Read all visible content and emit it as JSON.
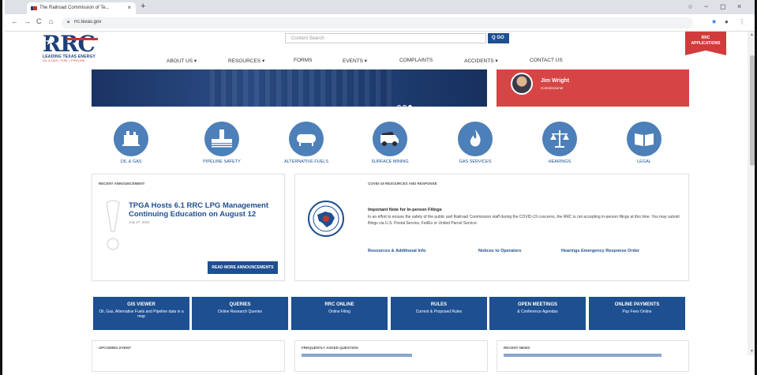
{
  "browser": {
    "tab_title": "The Railroad Commission of Te...",
    "tab_close": "×",
    "new_tab": "+",
    "url": "rrc.texas.gov",
    "win_controls": [
      "○",
      "−",
      "◻",
      "×"
    ]
  },
  "header": {
    "logo_text": "RRC",
    "logo_tagline": "LEADING TEXAS ENERGY",
    "logo_sub": "OIL & GAS • FUEL • PIPELINE",
    "search_placeholder": "Content Search",
    "go_label": "Q GO",
    "apps_label_1": "RRC",
    "apps_label_2": "APPLICATIONS"
  },
  "nav": {
    "items": [
      "ABOUT US ▾",
      "RESOURCES ▾",
      "FORMS",
      "EVENTS ▾",
      "COMPLAINTS",
      "ACCIDENTS ▾",
      "CONTACT US"
    ]
  },
  "hero": {
    "commissioner_name": "Jim Wright",
    "commissioner_role": "Commissioner"
  },
  "categories": [
    {
      "label": "OIL & GAS",
      "icon": "oil-rig-icon"
    },
    {
      "label": "PIPELINE SAFETY",
      "icon": "pipeline-icon"
    },
    {
      "label": "ALTERNATIVE FUELS",
      "icon": "fuel-tank-icon"
    },
    {
      "label": "SURFACE MINING",
      "icon": "mining-truck-icon"
    },
    {
      "label": "GAS SERVICES",
      "icon": "flame-icon"
    },
    {
      "label": "HEARINGS",
      "icon": "scales-icon"
    },
    {
      "label": "LEGAL",
      "icon": "book-icon"
    }
  ],
  "announcement": {
    "section_title": "RECENT ANNOUNCEMENT",
    "headline": "TPGA Hosts 6.1 RRC LPG Management Continuing Education on August 12",
    "date": "July 27, 2021",
    "button": "READ MORE ANNOUNCEMENTS"
  },
  "covid": {
    "section_title": "COVID-19 RESOURCES AND RESPONSE",
    "note_title": "Important Note for In-person Filings",
    "note_body": "In an effort to ensure the safety of the public and Railroad Commission staff during the COVID-19 concerns, the RRC is not accepting in-person filings at this time. You may submit filings via U.S. Postal Service, FedEx or United Parcel Service.",
    "links": [
      "Resources & Additional Info",
      "Notices to Operators",
      "Hearings Emergency Response Order"
    ]
  },
  "tiles": [
    {
      "title": "GIS VIEWER",
      "sub": "Oil, Gas, Alternative Fuels and Pipeline data in a map"
    },
    {
      "title": "QUERIES",
      "sub": "Online Research Queries"
    },
    {
      "title": "RRC ONLINE",
      "sub": "Online Filing"
    },
    {
      "title": "RULES",
      "sub": "Current & Proposed Rules"
    },
    {
      "title": "OPEN MEETINGS",
      "sub": "& Conference Agendas"
    },
    {
      "title": "ONLINE PAYMENTS",
      "sub": "Pay Fees Online"
    }
  ],
  "bottom": {
    "upcoming": "UPCOMING EVENT",
    "faq": "FREQUENTLY ASKED QUESTION",
    "news": "RECENT NEWS"
  },
  "colors": {
    "brand_blue": "#1d4f91",
    "brand_red": "#d23b3b",
    "icon_blue": "#4d7fb8"
  }
}
